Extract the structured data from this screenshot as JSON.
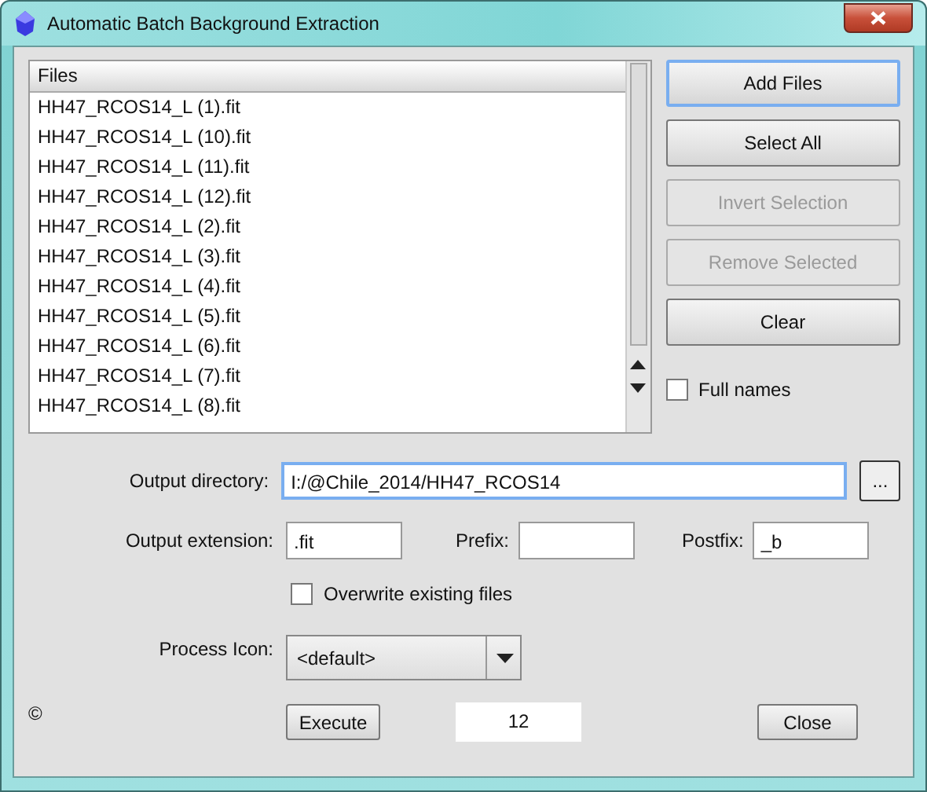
{
  "window": {
    "title": "Automatic Batch Background Extraction"
  },
  "file_list": {
    "header": "Files",
    "files": [
      "HH47_RCOS14_L (1).fit",
      "HH47_RCOS14_L (10).fit",
      "HH47_RCOS14_L (11).fit",
      "HH47_RCOS14_L (12).fit",
      "HH47_RCOS14_L (2).fit",
      "HH47_RCOS14_L (3).fit",
      "HH47_RCOS14_L (4).fit",
      "HH47_RCOS14_L (5).fit",
      "HH47_RCOS14_L (6).fit",
      "HH47_RCOS14_L (7).fit",
      "HH47_RCOS14_L (8).fit"
    ]
  },
  "buttons": [
    {
      "label": "Add Files",
      "disabled": false,
      "focused": true
    },
    {
      "label": "Select All",
      "disabled": false,
      "focused": false
    },
    {
      "label": "Invert Selection",
      "disabled": true,
      "focused": false
    },
    {
      "label": "Remove Selected",
      "disabled": true,
      "focused": false
    },
    {
      "label": "Clear",
      "disabled": false,
      "focused": false
    }
  ],
  "full_names": {
    "label": "Full names",
    "checked": false
  },
  "output_directory": {
    "label": "Output directory:",
    "value": "I:/@Chile_2014/HH47_RCOS14",
    "browse": "..."
  },
  "output_extension": {
    "label": "Output extension:",
    "value": ".fit"
  },
  "prefix": {
    "label": "Prefix:"
  },
  "postfix": {
    "label": "Postfix:",
    "value": "_b"
  },
  "overwrite": {
    "label": "Overwrite existing files",
    "checked": false
  },
  "process_icon": {
    "label": "Process Icon:",
    "value": "<default>"
  },
  "copyright": "©",
  "execute_button": "Execute",
  "count": "12",
  "close_button": "Close"
}
